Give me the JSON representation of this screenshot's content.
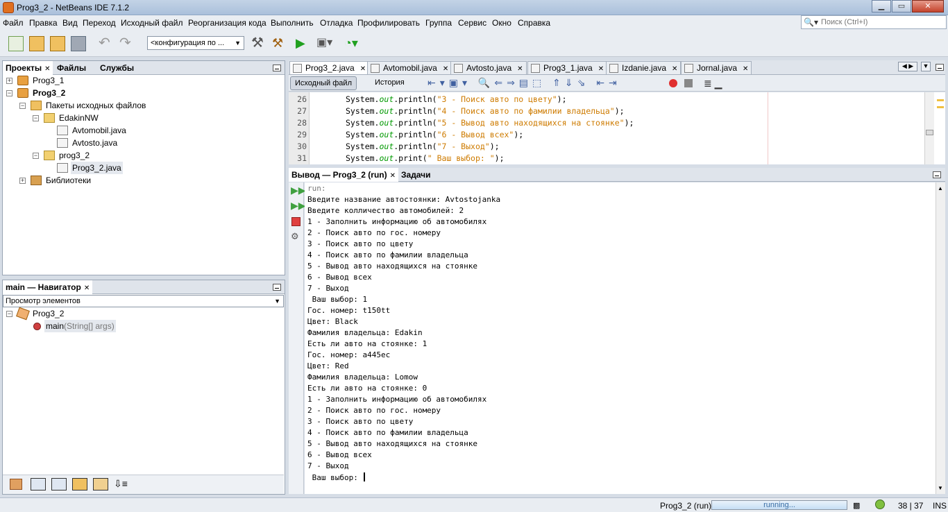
{
  "window": {
    "title": "Prog3_2 - NetBeans IDE 7.1.2",
    "min": "0",
    "max": "1",
    "close": "✕"
  },
  "menu": [
    "Файл",
    "Правка",
    "Вид",
    "Переход",
    "Исходный файл",
    "Реорганизация кода",
    "Выполнить",
    "Отладка",
    "Профилировать",
    "Группа",
    "Сервис",
    "Окно",
    "Справка"
  ],
  "search": {
    "placeholder": "Поиск (Ctrl+I)"
  },
  "toolbar": {
    "config": "<конфигурация по ..."
  },
  "projects_panel": {
    "tabs": [
      "Проекты",
      "Файлы",
      "Службы"
    ],
    "tree": [
      {
        "label": "Prog3_1",
        "bold": false
      },
      {
        "label": "Prog3_2",
        "bold": true
      },
      {
        "label": "Пакеты исходных файлов"
      },
      {
        "label": "EdakinNW"
      },
      {
        "label": "Avtomobil.java"
      },
      {
        "label": "Avtosto.java"
      },
      {
        "label": "prog3_2"
      },
      {
        "label": "Prog3_2.java"
      },
      {
        "label": "Библиотеки"
      }
    ]
  },
  "navigator": {
    "title": "main — Навигатор",
    "combo": "Просмотр элементов",
    "root": "Prog3_2",
    "method_name": "main",
    "method_params": "(String[] args)"
  },
  "editor": {
    "tabs": [
      "Prog3_2.java",
      "Avtomobil.java",
      "Avtosto.java",
      "Prog3_1.java",
      "Izdanie.java",
      "Jornal.java"
    ],
    "source_tab": "Исходный файл",
    "history_tab": "История",
    "lines": [
      {
        "num": "26",
        "prefix": "System.",
        "out": "out",
        "method": ".println(",
        "str": "\"3 - Поиск авто по цвету\"",
        "end": ");"
      },
      {
        "num": "27",
        "prefix": "System.",
        "out": "out",
        "method": ".println(",
        "str": "\"4 - Поиск авто по фамилии владельца\"",
        "end": ");"
      },
      {
        "num": "28",
        "prefix": "System.",
        "out": "out",
        "method": ".println(",
        "str": "\"5 - Вывод авто находящихся на стоянке\"",
        "end": ");"
      },
      {
        "num": "29",
        "prefix": "System.",
        "out": "out",
        "method": ".println(",
        "str": "\"6 - Вывод всех\"",
        "end": ");"
      },
      {
        "num": "30",
        "prefix": "System.",
        "out": "out",
        "method": ".println(",
        "str": "\"7 - Выход\"",
        "end": ");"
      },
      {
        "num": "31",
        "prefix": "System.",
        "out": "out",
        "method": ".print(",
        "str": "\" Ваш выбор: \"",
        "end": ");"
      }
    ]
  },
  "output": {
    "tabs": [
      "Вывод — Prog3_2 (run)",
      "Задачи"
    ],
    "lines": [
      "run:",
      "Введите название автостоянки: Avtostojanka",
      "Введите колличество автомобилей: 2",
      "1 - Заполнить информацию об автомобилях",
      "2 - Поиск авто по гос. номеру",
      "3 - Поиск авто по цвету",
      "4 - Поиск авто по фамилии владельца",
      "5 - Вывод авто находящихся на стоянке",
      "6 - Вывод всех",
      "7 - Выход",
      " Ваш выбор: 1",
      "Гос. номер: t150tt",
      "Цвет: Black",
      "Фамилия владельца: Edakin",
      "Есть ли авто на стоянке: 1",
      "Гос. номер: a445ec",
      "Цвет: Red",
      "Фамилия владельца: Lomow",
      "Есть ли авто на стоянке: 0",
      "1 - Заполнить информацию об автомобилях",
      "2 - Поиск авто по гос. номеру",
      "3 - Поиск авто по цвету",
      "4 - Поиск авто по фамилии владельца",
      "5 - Вывод авто находящихся на стоянке",
      "6 - Вывод всех",
      "7 - Выход",
      " Ваш выбор: "
    ]
  },
  "status": {
    "task": "Prog3_2 (run)",
    "progress": "running...",
    "position": "38 | 37",
    "mode": "INS"
  }
}
